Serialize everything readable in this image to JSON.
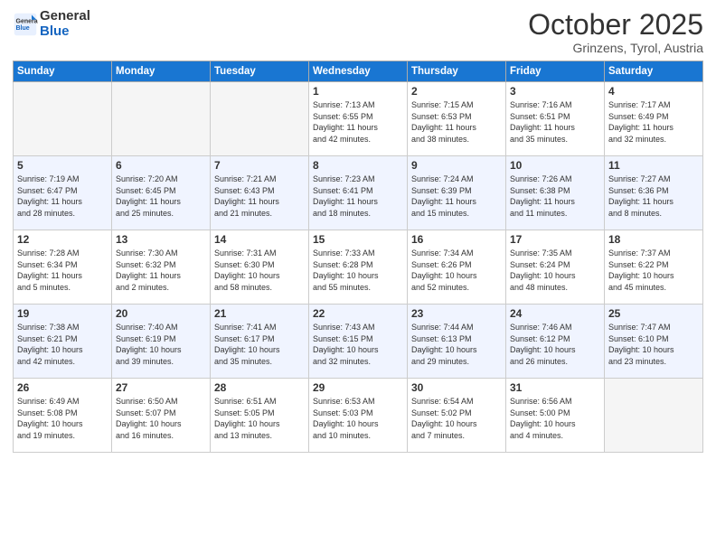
{
  "logo": {
    "general": "General",
    "blue": "Blue"
  },
  "header": {
    "title": "October 2025",
    "location": "Grinzens, Tyrol, Austria"
  },
  "weekdays": [
    "Sunday",
    "Monday",
    "Tuesday",
    "Wednesday",
    "Thursday",
    "Friday",
    "Saturday"
  ],
  "weeks": [
    [
      {
        "day": "",
        "info": ""
      },
      {
        "day": "",
        "info": ""
      },
      {
        "day": "",
        "info": ""
      },
      {
        "day": "1",
        "info": "Sunrise: 7:13 AM\nSunset: 6:55 PM\nDaylight: 11 hours\nand 42 minutes."
      },
      {
        "day": "2",
        "info": "Sunrise: 7:15 AM\nSunset: 6:53 PM\nDaylight: 11 hours\nand 38 minutes."
      },
      {
        "day": "3",
        "info": "Sunrise: 7:16 AM\nSunset: 6:51 PM\nDaylight: 11 hours\nand 35 minutes."
      },
      {
        "day": "4",
        "info": "Sunrise: 7:17 AM\nSunset: 6:49 PM\nDaylight: 11 hours\nand 32 minutes."
      }
    ],
    [
      {
        "day": "5",
        "info": "Sunrise: 7:19 AM\nSunset: 6:47 PM\nDaylight: 11 hours\nand 28 minutes."
      },
      {
        "day": "6",
        "info": "Sunrise: 7:20 AM\nSunset: 6:45 PM\nDaylight: 11 hours\nand 25 minutes."
      },
      {
        "day": "7",
        "info": "Sunrise: 7:21 AM\nSunset: 6:43 PM\nDaylight: 11 hours\nand 21 minutes."
      },
      {
        "day": "8",
        "info": "Sunrise: 7:23 AM\nSunset: 6:41 PM\nDaylight: 11 hours\nand 18 minutes."
      },
      {
        "day": "9",
        "info": "Sunrise: 7:24 AM\nSunset: 6:39 PM\nDaylight: 11 hours\nand 15 minutes."
      },
      {
        "day": "10",
        "info": "Sunrise: 7:26 AM\nSunset: 6:38 PM\nDaylight: 11 hours\nand 11 minutes."
      },
      {
        "day": "11",
        "info": "Sunrise: 7:27 AM\nSunset: 6:36 PM\nDaylight: 11 hours\nand 8 minutes."
      }
    ],
    [
      {
        "day": "12",
        "info": "Sunrise: 7:28 AM\nSunset: 6:34 PM\nDaylight: 11 hours\nand 5 minutes."
      },
      {
        "day": "13",
        "info": "Sunrise: 7:30 AM\nSunset: 6:32 PM\nDaylight: 11 hours\nand 2 minutes."
      },
      {
        "day": "14",
        "info": "Sunrise: 7:31 AM\nSunset: 6:30 PM\nDaylight: 10 hours\nand 58 minutes."
      },
      {
        "day": "15",
        "info": "Sunrise: 7:33 AM\nSunset: 6:28 PM\nDaylight: 10 hours\nand 55 minutes."
      },
      {
        "day": "16",
        "info": "Sunrise: 7:34 AM\nSunset: 6:26 PM\nDaylight: 10 hours\nand 52 minutes."
      },
      {
        "day": "17",
        "info": "Sunrise: 7:35 AM\nSunset: 6:24 PM\nDaylight: 10 hours\nand 48 minutes."
      },
      {
        "day": "18",
        "info": "Sunrise: 7:37 AM\nSunset: 6:22 PM\nDaylight: 10 hours\nand 45 minutes."
      }
    ],
    [
      {
        "day": "19",
        "info": "Sunrise: 7:38 AM\nSunset: 6:21 PM\nDaylight: 10 hours\nand 42 minutes."
      },
      {
        "day": "20",
        "info": "Sunrise: 7:40 AM\nSunset: 6:19 PM\nDaylight: 10 hours\nand 39 minutes."
      },
      {
        "day": "21",
        "info": "Sunrise: 7:41 AM\nSunset: 6:17 PM\nDaylight: 10 hours\nand 35 minutes."
      },
      {
        "day": "22",
        "info": "Sunrise: 7:43 AM\nSunset: 6:15 PM\nDaylight: 10 hours\nand 32 minutes."
      },
      {
        "day": "23",
        "info": "Sunrise: 7:44 AM\nSunset: 6:13 PM\nDaylight: 10 hours\nand 29 minutes."
      },
      {
        "day": "24",
        "info": "Sunrise: 7:46 AM\nSunset: 6:12 PM\nDaylight: 10 hours\nand 26 minutes."
      },
      {
        "day": "25",
        "info": "Sunrise: 7:47 AM\nSunset: 6:10 PM\nDaylight: 10 hours\nand 23 minutes."
      }
    ],
    [
      {
        "day": "26",
        "info": "Sunrise: 6:49 AM\nSunset: 5:08 PM\nDaylight: 10 hours\nand 19 minutes."
      },
      {
        "day": "27",
        "info": "Sunrise: 6:50 AM\nSunset: 5:07 PM\nDaylight: 10 hours\nand 16 minutes."
      },
      {
        "day": "28",
        "info": "Sunrise: 6:51 AM\nSunset: 5:05 PM\nDaylight: 10 hours\nand 13 minutes."
      },
      {
        "day": "29",
        "info": "Sunrise: 6:53 AM\nSunset: 5:03 PM\nDaylight: 10 hours\nand 10 minutes."
      },
      {
        "day": "30",
        "info": "Sunrise: 6:54 AM\nSunset: 5:02 PM\nDaylight: 10 hours\nand 7 minutes."
      },
      {
        "day": "31",
        "info": "Sunrise: 6:56 AM\nSunset: 5:00 PM\nDaylight: 10 hours\nand 4 minutes."
      },
      {
        "day": "",
        "info": ""
      }
    ]
  ]
}
